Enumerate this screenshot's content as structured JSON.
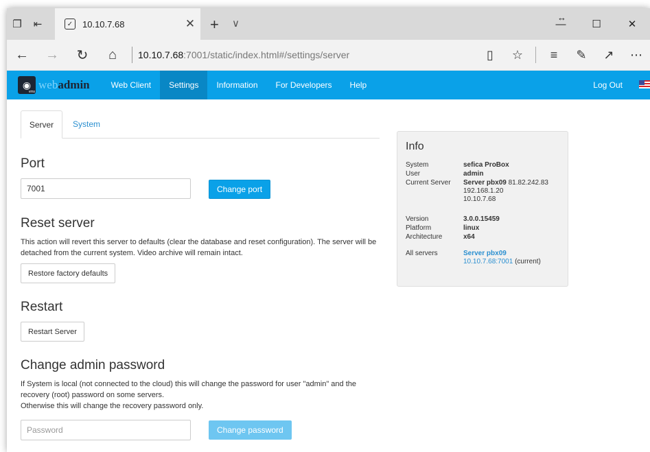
{
  "browser": {
    "tab_title": "10.10.7.68",
    "url_host": "10.10.7.68",
    "url_rest": ":7001/static/index.html#/settings/server"
  },
  "nav": {
    "logo_web": "web",
    "logo_admin": "admin",
    "items": [
      "Web Client",
      "Settings",
      "Information",
      "For Developers",
      "Help"
    ],
    "active": "Settings",
    "logout": "Log Out"
  },
  "tabs": [
    "Server",
    "System"
  ],
  "port": {
    "heading": "Port",
    "value": "7001",
    "button": "Change port"
  },
  "reset": {
    "heading": "Reset server",
    "text": "This action will revert this server to defaults (clear the database and reset configuration). The server will be detached from the current system. Video archive will remain intact.",
    "button": "Restore factory defaults"
  },
  "restart": {
    "heading": "Restart",
    "button": "Restart Server"
  },
  "password": {
    "heading": "Change admin password",
    "text1": "If System is local (not connected to the cloud) this will change the password for user \"admin\" and the recovery (root) password on some servers.",
    "text2": "Otherwise this will change the recovery password only.",
    "placeholder": "Password",
    "button": "Change password"
  },
  "info": {
    "title": "Info",
    "system_label": "System",
    "system_value": "sefica ProBox",
    "user_label": "User",
    "user_value": "admin",
    "current_server_label": "Current Server",
    "current_server_name": "Server pbx09",
    "current_server_ips": [
      "81.82.242.83",
      "192.168.1.20",
      "10.10.7.68"
    ],
    "version_label": "Version",
    "version_value": "3.0.0.15459",
    "platform_label": "Platform",
    "platform_value": "linux",
    "arch_label": "Architecture",
    "arch_value": "x64",
    "all_servers_label": "All servers",
    "all_servers_name": "Server pbx09",
    "all_servers_addr": "10.10.7.68:7001",
    "all_servers_current": "(current)"
  },
  "colors": {
    "accent": "#0aa1e8",
    "accent_active": "#0987c5",
    "link": "#2a8fd0"
  }
}
